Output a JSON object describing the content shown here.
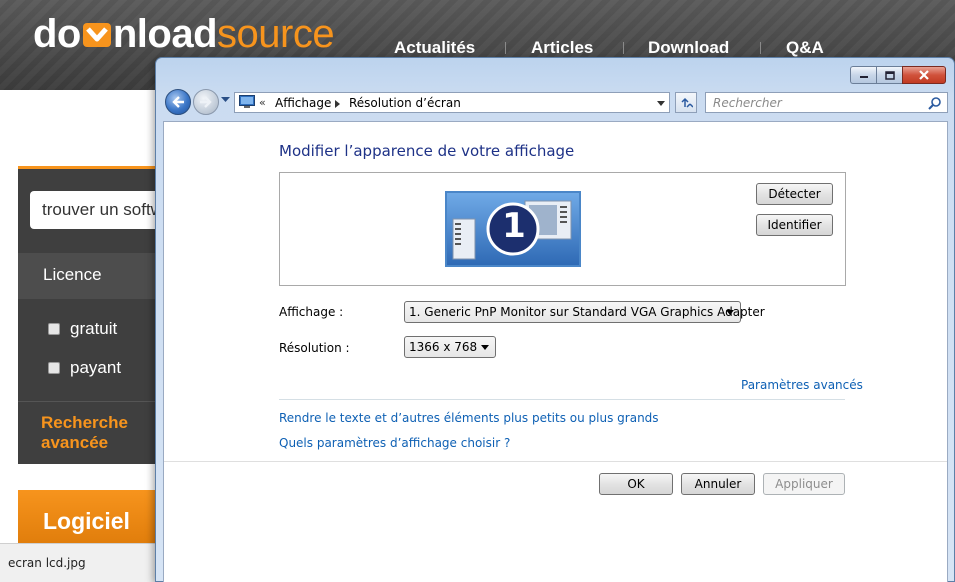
{
  "site": {
    "logo": {
      "part1": "do",
      "part2": "nload",
      "part3": "source"
    },
    "nav": [
      "Actualités",
      "Articles",
      "Download",
      "Q&A"
    ],
    "search_value": "trouver un software",
    "licence_label": "Licence",
    "filters": [
      "gratuit",
      "payant"
    ],
    "advanced_search": "Recherche avancée",
    "logiciel_tab": "Logiciel",
    "colors": {
      "accent": "#f7941d",
      "header": "#4a4a4a",
      "sidebar": "#3f3f3f"
    }
  },
  "download_bar": {
    "filename": "ecran lcd.jpg"
  },
  "window": {
    "controls": {
      "minimize": "minimize-icon",
      "maximize": "maximize-icon",
      "close": "close-icon"
    },
    "breadcrumb": {
      "chevron": "«",
      "items": [
        "Affichage",
        "Résolution d’écran"
      ]
    },
    "search_placeholder": "Rechercher",
    "title": "Modifier l’apparence de votre affichage",
    "monitor_number": "1",
    "buttons": {
      "detect": "Détecter",
      "identify": "Identifier"
    },
    "display_label": "Affichage :",
    "display_value": "1. Generic PnP Monitor sur Standard VGA Graphics Adapter",
    "resolution_label": "Résolution :",
    "resolution_value": "1366 x 768",
    "advanced_link": "Paramètres avancés",
    "link_text_size": "Rendre le texte et d’autres éléments plus petits ou plus grands",
    "link_which_settings": "Quels paramètres d’affichage choisir ?",
    "footer": {
      "ok": "OK",
      "cancel": "Annuler",
      "apply": "Appliquer"
    }
  }
}
